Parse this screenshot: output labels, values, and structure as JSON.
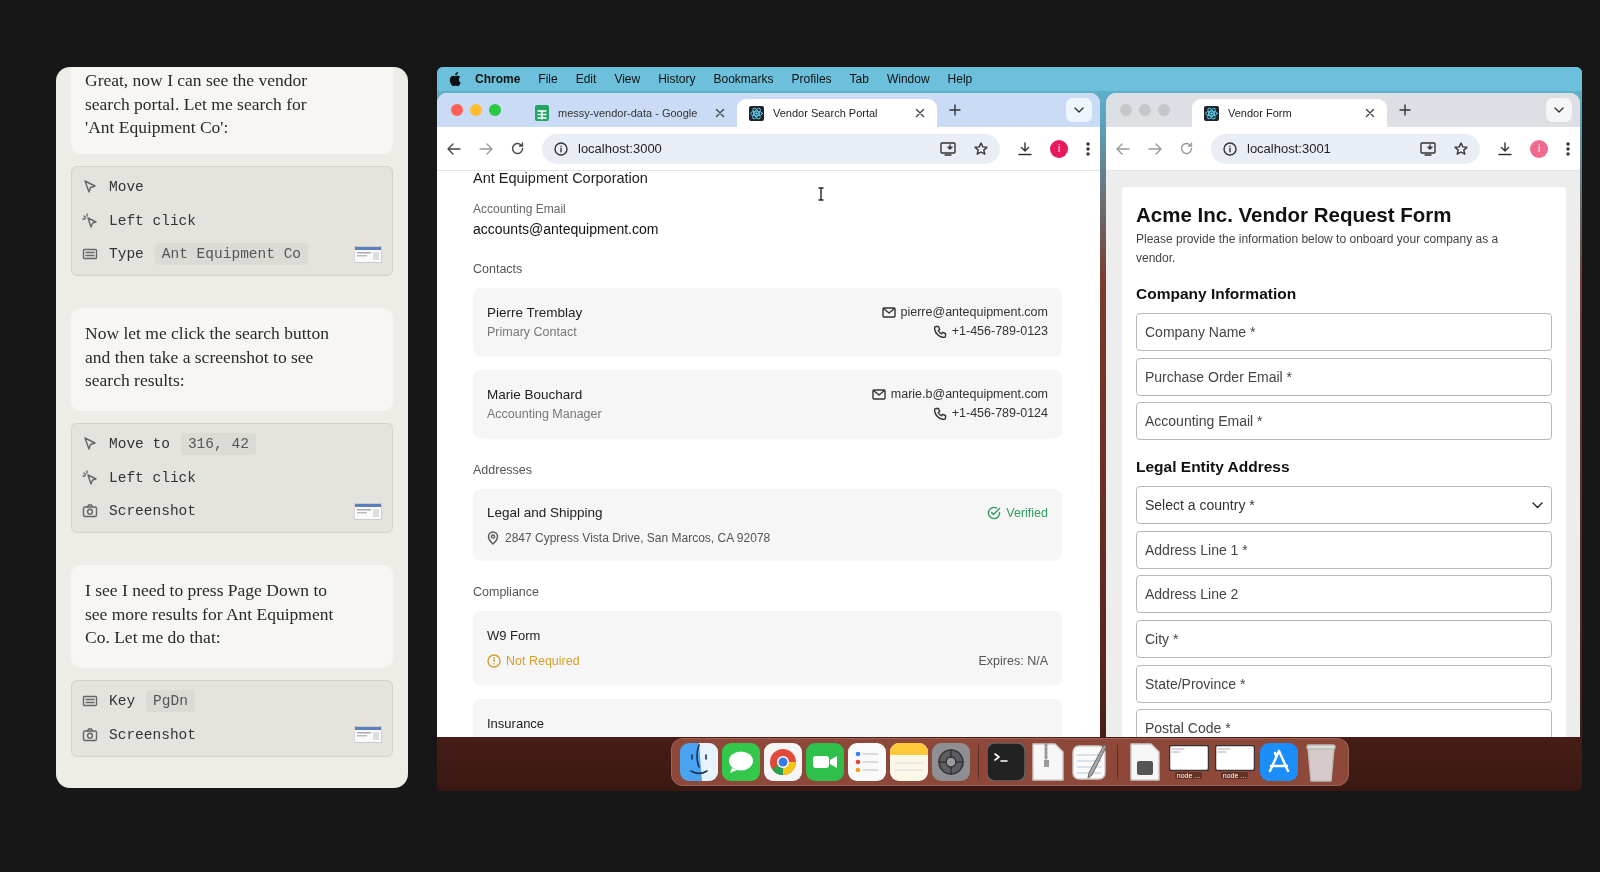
{
  "chat": {
    "items": [
      {
        "kind": "message",
        "text": "Great, now I can see the vendor search portal. Let me search for 'Ant Equipment Co':"
      },
      {
        "kind": "actions",
        "actions": [
          {
            "kind": "move",
            "label": "Move"
          },
          {
            "kind": "click",
            "label": "Left click"
          },
          {
            "kind": "type",
            "label": "Type",
            "argument": "Ant Equipment Co"
          }
        ]
      },
      {
        "kind": "message",
        "text": "Now let me click the search button and then take a screenshot to see search results:"
      },
      {
        "kind": "actions",
        "actions": [
          {
            "kind": "move",
            "label": "Move to",
            "argument": "316, 42"
          },
          {
            "kind": "click",
            "label": "Left click"
          },
          {
            "kind": "screenshot",
            "label": "Screenshot"
          }
        ]
      },
      {
        "kind": "message",
        "text": "I see I need to press Page Down to see more results for Ant Equipment Co. Let me do that:"
      },
      {
        "kind": "actions",
        "actions": [
          {
            "kind": "key",
            "label": "Key",
            "argument": "PgDn"
          },
          {
            "kind": "screenshot",
            "label": "Screenshot"
          }
        ]
      }
    ]
  },
  "menu_bar": {
    "items": [
      "Chrome",
      "File",
      "Edit",
      "View",
      "History",
      "Bookmarks",
      "Profiles",
      "Tab",
      "Window",
      "Help"
    ]
  },
  "windows": [
    {
      "focused": true,
      "tabs": [
        {
          "title": "messy-vendor-data - Google",
          "kind": "sheet",
          "selected": false
        },
        {
          "title": "Vendor Search Portal",
          "kind": "atom",
          "selected": true
        }
      ],
      "url": "localhost:3000",
      "avatar": "i",
      "page": {
        "kind": "portal",
        "company": "Ant Equipment Corporation",
        "fields": [
          {
            "label": "Accounting Email",
            "value": "accounts@antequipment.com"
          }
        ],
        "contacts_label": "Contacts",
        "contacts": [
          {
            "name": "Pierre Tremblay",
            "role": "Primary Contact",
            "email": "pierre@antequipment.com",
            "phone": "+1-456-789-0123"
          },
          {
            "name": "Marie Bouchard",
            "role": "Accounting Manager",
            "email": "marie.b@antequipment.com",
            "phone": "+1-456-789-0124"
          }
        ],
        "addresses_label": "Addresses",
        "addresses": [
          {
            "title": "Legal and Shipping",
            "address": "2847 Cypress Vista Drive, San Marcos, CA 92078",
            "status": {
              "kind": "verified",
              "text": "Verified"
            }
          }
        ],
        "compliance_label": "Compliance",
        "compliance": [
          {
            "title": "W9 Form",
            "status": {
              "kind": "warning",
              "text": "Not Required"
            },
            "expires": "Expires: N/A"
          },
          {
            "title": "Insurance"
          }
        ]
      }
    },
    {
      "focused": false,
      "tabs": [
        {
          "title": "Vendor Form",
          "kind": "atom",
          "selected": true
        }
      ],
      "url": "localhost:3001",
      "avatar": "i",
      "page": {
        "kind": "form",
        "title": "Acme Inc. Vendor Request Form",
        "subtitle": "Please provide the information below to onboard your company as a vendor.",
        "sections": [
          {
            "heading": "Company Information",
            "fields": [
              {
                "kind": "input",
                "placeholder": "Company Name *"
              },
              {
                "kind": "input",
                "placeholder": "Purchase Order Email *"
              },
              {
                "kind": "input",
                "placeholder": "Accounting Email *"
              }
            ]
          },
          {
            "heading": "Legal Entity Address",
            "fields": [
              {
                "kind": "select",
                "placeholder": "Select a country *"
              },
              {
                "kind": "input",
                "placeholder": "Address Line 1 *"
              },
              {
                "kind": "input",
                "placeholder": "Address Line 2"
              },
              {
                "kind": "input",
                "placeholder": "City *"
              },
              {
                "kind": "input",
                "placeholder": "State/Province *"
              },
              {
                "kind": "input",
                "placeholder": "Postal Code *"
              }
            ]
          }
        ]
      }
    }
  ],
  "dock": {
    "items": [
      {
        "kind": "face"
      },
      {
        "kind": "bubble"
      },
      {
        "kind": "browser"
      },
      {
        "kind": "camera"
      },
      {
        "kind": "list"
      },
      {
        "kind": "notes"
      },
      {
        "kind": "gear"
      },
      {
        "kind": "separator"
      },
      {
        "kind": "terminal"
      },
      {
        "kind": "zip"
      },
      {
        "kind": "pencil"
      },
      {
        "kind": "separator"
      },
      {
        "kind": "document"
      },
      {
        "kind": "window",
        "label": "node ..."
      },
      {
        "kind": "window",
        "label": "node ..."
      },
      {
        "kind": "letter-a"
      },
      {
        "kind": "trash"
      }
    ]
  }
}
